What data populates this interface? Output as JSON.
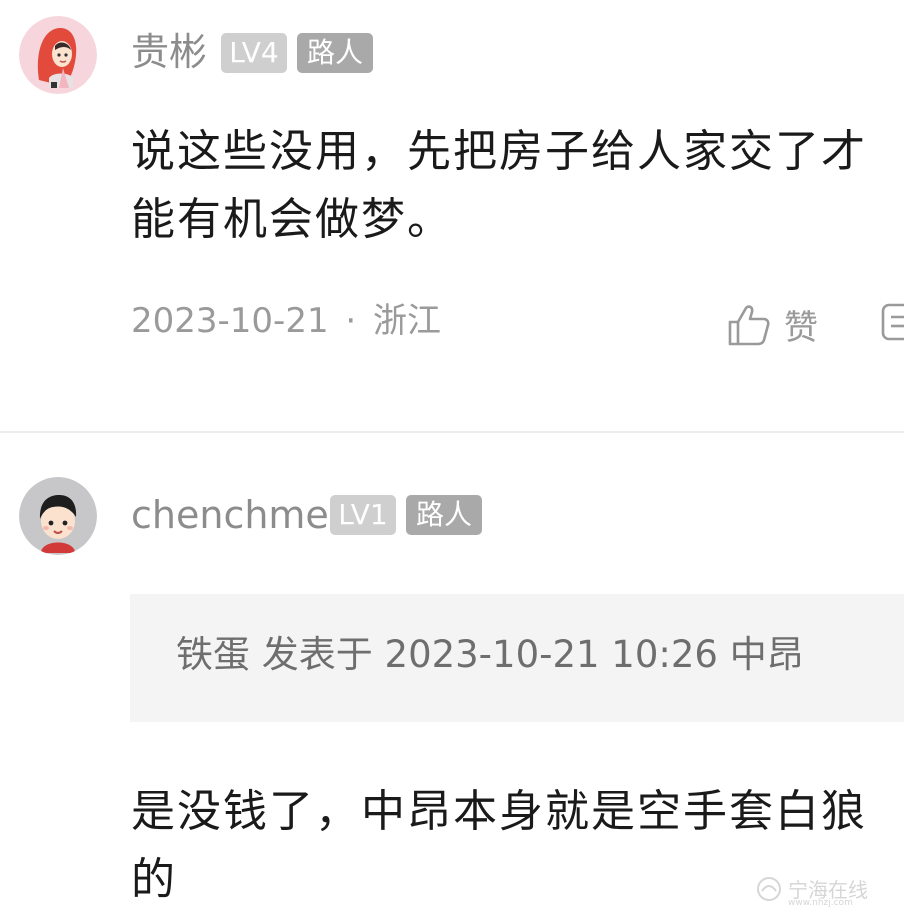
{
  "comments": [
    {
      "username": "贵彬",
      "level": "LV4",
      "role": "路人",
      "content_lines": [
        "说这些没用，先把房子给人家交了才",
        "能有机会做梦。"
      ],
      "date": "2023-10-21",
      "location": "浙江",
      "meta_separator": "·",
      "like_label": "赞",
      "avatar_icon": "girl-red-hood-avatar"
    },
    {
      "username": "chenchme",
      "level": "LV1",
      "role": "路人",
      "quote": "铁蛋 发表于 2023-10-21 10:26 中昂",
      "content_lines": [
        "是没钱了，中昂本身就是空手套白狼",
        "的"
      ],
      "avatar_icon": "boy-cartoon-avatar"
    }
  ],
  "watermark": {
    "text": "宁海在线",
    "url": "www.nhzj.com"
  },
  "colors": {
    "username": "#8c8c8c",
    "level_badge": "#cfcfcf",
    "role_badge": "#a9a9a9",
    "content": "#1a1a1a",
    "meta": "#9a9a9a",
    "quote_bg": "#f4f4f4"
  }
}
